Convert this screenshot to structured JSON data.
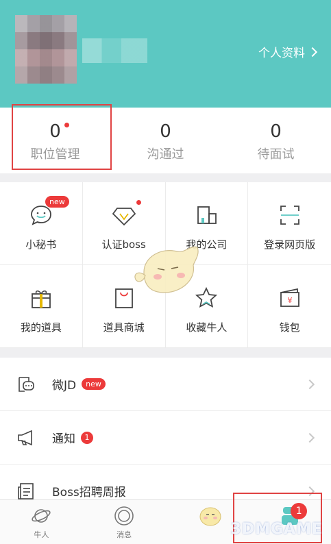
{
  "header": {
    "profile_link": "个人资料"
  },
  "stats": [
    {
      "value": "0",
      "label": "职位管理",
      "dot": true
    },
    {
      "value": "0",
      "label": "沟通过",
      "dot": false
    },
    {
      "value": "0",
      "label": "待面试",
      "dot": false
    }
  ],
  "grid": [
    {
      "label": "小秘书",
      "icon": "chat-smile-icon",
      "badge": "new"
    },
    {
      "label": "认证boss",
      "icon": "diamond-icon",
      "dot": true
    },
    {
      "label": "我的公司",
      "icon": "building-icon"
    },
    {
      "label": "登录网页版",
      "icon": "scan-icon"
    },
    {
      "label": "我的道具",
      "icon": "gift-icon"
    },
    {
      "label": "道具商城",
      "icon": "shopping-bag-icon"
    },
    {
      "label": "收藏牛人",
      "icon": "star-icon"
    },
    {
      "label": "钱包",
      "icon": "wallet-icon",
      "symbol": "¥"
    }
  ],
  "list": [
    {
      "label": "微JD",
      "icon": "chat-doc-icon",
      "badge": "new"
    },
    {
      "label": "通知",
      "icon": "megaphone-icon",
      "count": "1"
    },
    {
      "label": "Boss招聘周报",
      "icon": "report-icon"
    }
  ],
  "tabbar": [
    {
      "label": "牛人",
      "icon": "planet-icon"
    },
    {
      "label": "消息",
      "icon": "message-icon"
    },
    {
      "label": "",
      "icon": "mascot-icon"
    },
    {
      "label": "",
      "icon": "me-icon",
      "badge": "1"
    }
  ],
  "watermark": "3DMGAME",
  "colors": {
    "accent": "#5cc8c2",
    "badge": "#ec3a3a",
    "highlight": "#e04343"
  }
}
